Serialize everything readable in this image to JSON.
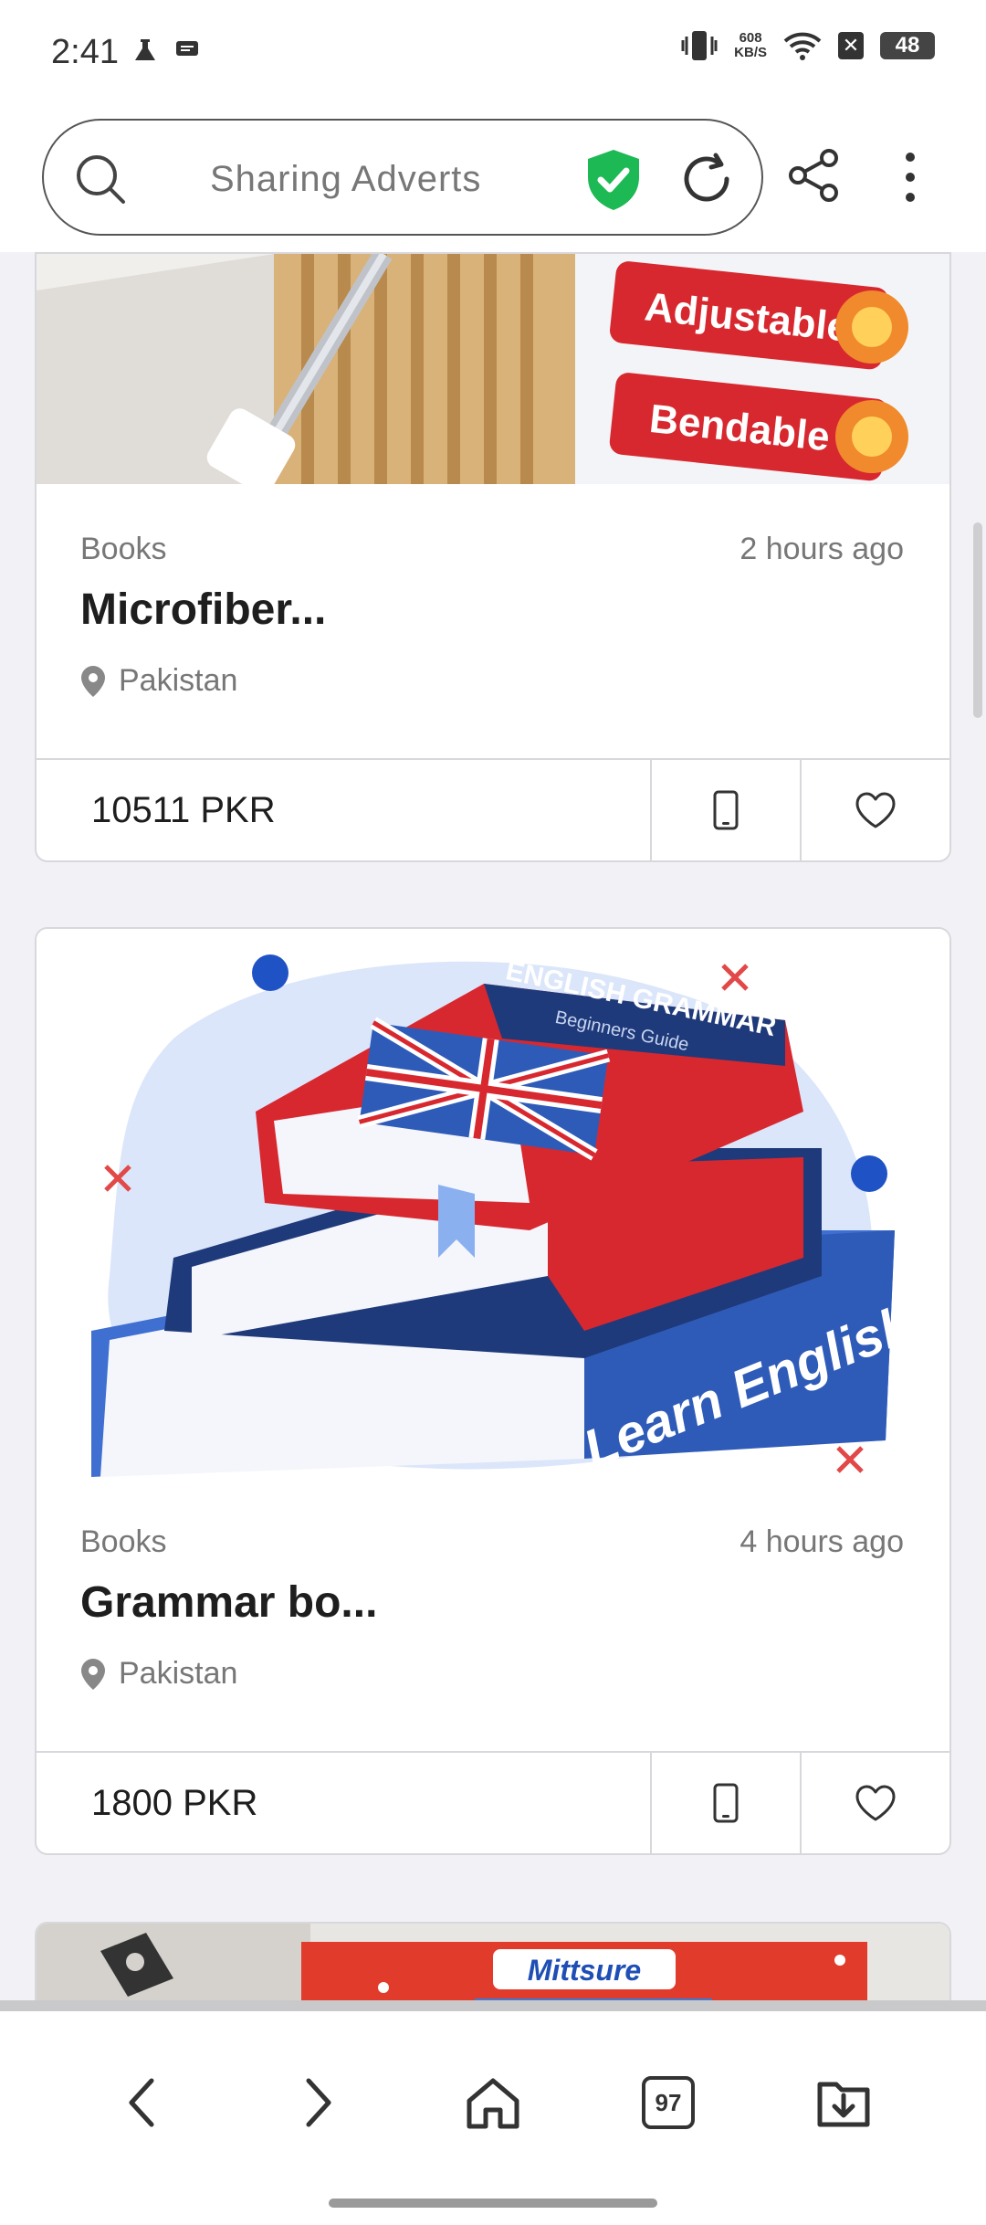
{
  "status_bar": {
    "time": "2:41",
    "netspeed_top": "608",
    "netspeed_bottom": "KB/S",
    "battery": "48"
  },
  "browser": {
    "search_text": "Sharing Adverts",
    "tab_count": "97"
  },
  "listings": [
    {
      "category": "Books",
      "time": "2 hours ago",
      "title": "Microfiber...",
      "location": "Pakistan",
      "price": "10511 PKR",
      "image_text": [
        "Adjustable",
        "Bendable"
      ]
    },
    {
      "category": "Books",
      "time": "4 hours ago",
      "title": "Grammar bo...",
      "location": "Pakistan",
      "price": "1800 PKR",
      "image_text": [
        "ENGLISH GRAMMAR",
        "Beginners Guide",
        "Learn English"
      ]
    },
    {
      "image_text": [
        "Mittsure"
      ]
    }
  ],
  "colors": {
    "accent_green": "#1db954",
    "badge_red": "#d8282f",
    "book_blue": "#3f6fd1",
    "book_navy": "#1f3a7a"
  }
}
